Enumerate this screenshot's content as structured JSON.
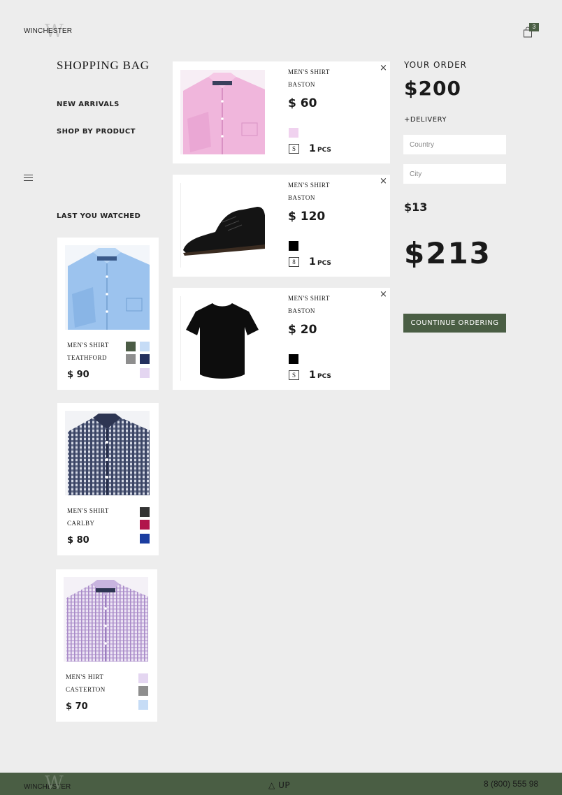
{
  "brand": {
    "name": "WINCHESTER",
    "monogram": "W"
  },
  "cart": {
    "count": "3"
  },
  "nav": {
    "title": "SHOPPING BAG",
    "links": [
      "NEW ARRIVALS",
      "SHOP BY PRODUCT"
    ],
    "watched_title": "LAST YOU WATCHED"
  },
  "watched": [
    {
      "type": "MEN'S SHIRT",
      "name": "TEATHFORD",
      "price": "$ 90",
      "image": "light-blue-shirt",
      "colors": [
        "#4b5c45",
        "#c6dcf6",
        "#8e8e8e",
        "#24305e",
        "#e4d6f1"
      ]
    },
    {
      "type": "MEN'S SHIRT",
      "name": "CARLBY",
      "price": "$ 80",
      "image": "navy-gingham-shirt",
      "colors": [
        "#333333",
        "#b1154b",
        "#1b3da0"
      ]
    },
    {
      "type": "MEN'S HIRT",
      "name": "CASTERTON",
      "price": "$ 70",
      "image": "lavender-check-shirt",
      "colors": [
        "#e4d6f1",
        "#8e8e8e",
        "#c6dcf6"
      ]
    }
  ],
  "bag": [
    {
      "type": "MEN'S SHIRT",
      "name": "BASTON",
      "price": "$ 60",
      "color": "#f0d2ef",
      "size": "S",
      "qty": "1",
      "unit": "PCS",
      "image": "pink-shirt"
    },
    {
      "type": "MEN'S SHIRT",
      "name": "BASTON",
      "price": "$ 120",
      "color": "#000000",
      "size": "8",
      "qty": "1",
      "unit": "PCS",
      "image": "black-suede-shoe"
    },
    {
      "type": "MEN'S SHIRT",
      "name": "BASTON",
      "price": "$ 20",
      "color": "#000000",
      "size": "S",
      "qty": "1",
      "unit": "PCS",
      "image": "black-tshirt"
    }
  ],
  "close_glyph": "×",
  "order": {
    "title": "YOUR ORDER",
    "subtotal": "$200",
    "delivery_label": "+DELIVERY",
    "country_placeholder": "Country",
    "city_placeholder": "City",
    "delivery_cost": "$13",
    "total": "$213",
    "cta": "COUNTINUE ORDERING"
  },
  "footer": {
    "brand": "WINCHESTER",
    "up": "UP",
    "phone": "8 (800) 555 98"
  },
  "colors": {
    "accent": "#4a5e44",
    "background": "#ededed",
    "card": "#ffffff"
  },
  "icons": {
    "cart": "shopping-bag-icon",
    "menu": "hamburger-menu-icon",
    "close": "close-icon",
    "up": "triangle-up-icon"
  }
}
